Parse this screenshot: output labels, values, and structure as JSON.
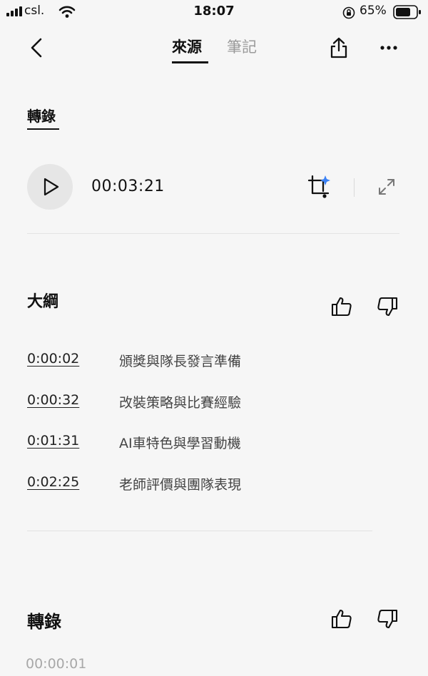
{
  "status_bar": {
    "carrier": "csl.",
    "time": "18:07",
    "battery_percent": "65%"
  },
  "nav": {
    "tabs": [
      {
        "label": "來源",
        "active": true
      },
      {
        "label": "筆記",
        "active": false
      }
    ]
  },
  "source_heading": "轉錄",
  "player": {
    "duration": "00:03:21"
  },
  "outline": {
    "title": "大綱",
    "items": [
      {
        "time": "0:00:02",
        "text": "頒獎與隊長發言準備"
      },
      {
        "time": "0:00:32",
        "text": "改裝策略與比賽經驗"
      },
      {
        "time": "0:01:31",
        "text": "AI車特色與學習動機"
      },
      {
        "time": "0:02:25",
        "text": "老師評價與團隊表現"
      }
    ]
  },
  "transcript": {
    "title": "轉錄",
    "first_timestamp": "00:00:01"
  },
  "icons": {
    "back": "chevron-left-icon",
    "share": "share-icon",
    "more": "more-icon",
    "play": "play-icon",
    "ai_crop": "ai-crop-icon",
    "expand": "expand-icon",
    "like": "thumbs-up-icon",
    "dislike": "thumbs-down-icon"
  },
  "colors": {
    "background": "#f6f6f6",
    "text": "#1c1c1c",
    "muted": "#9a9a9a",
    "ai_accent": "#3b82f6"
  }
}
